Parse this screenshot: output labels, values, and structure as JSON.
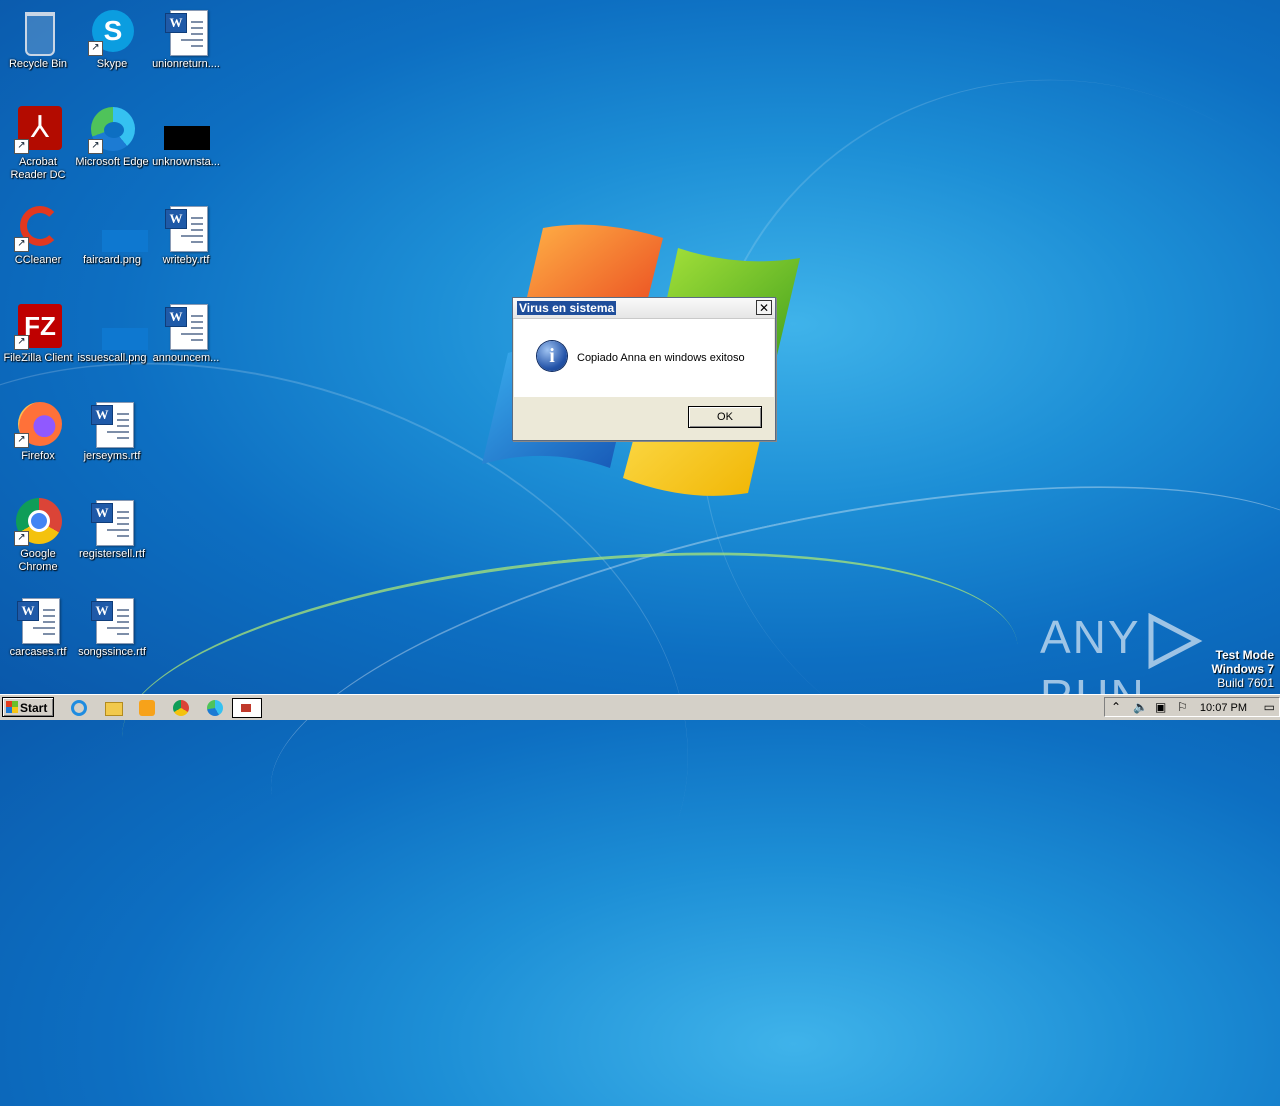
{
  "desktop": {
    "icons": [
      {
        "label": "Recycle Bin"
      },
      {
        "label": "Skype"
      },
      {
        "label": "unionreturn...."
      },
      {
        "label": "Acrobat Reader DC"
      },
      {
        "label": "Microsoft Edge"
      },
      {
        "label": "unknownsta..."
      },
      {
        "label": "CCleaner"
      },
      {
        "label": "faircard.png"
      },
      {
        "label": "writeby.rtf"
      },
      {
        "label": "FileZilla Client"
      },
      {
        "label": "issuescall.png"
      },
      {
        "label": "announcem..."
      },
      {
        "label": "Firefox"
      },
      {
        "label": "jerseyms.rtf"
      },
      {
        "label": "Google Chrome"
      },
      {
        "label": "registersell.rtf"
      },
      {
        "label": "carcases.rtf"
      },
      {
        "label": "songssince.rtf"
      }
    ]
  },
  "dialog": {
    "title": "Virus en sistema",
    "message": "Copiado Anna en windows exitoso",
    "ok_label": "OK",
    "close_glyph": "✕"
  },
  "watermark": {
    "brand_left": "ANY",
    "brand_right": "RUN",
    "test_mode": "Test Mode",
    "os": "Windows 7",
    "build": "Build 7601"
  },
  "taskbar": {
    "start_label": "Start",
    "clock": "10:07 PM"
  },
  "colors": {
    "desktop": "#1d8fd6",
    "taskbar": "#d4d0c8",
    "dialog_title_highlight": "#1f4e9b"
  }
}
